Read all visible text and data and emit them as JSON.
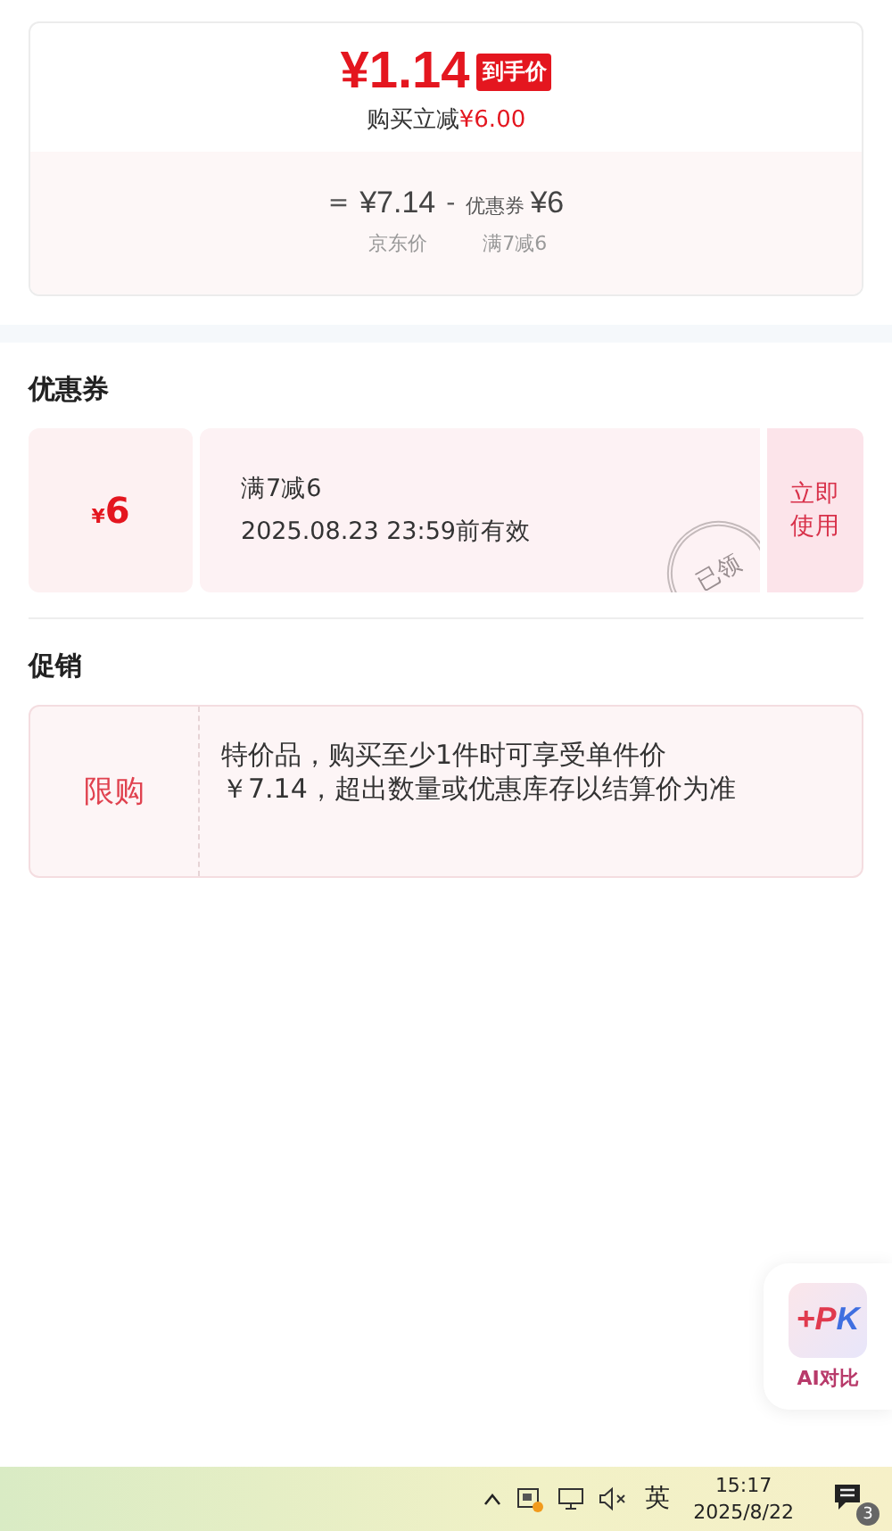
{
  "price_card": {
    "final_price": "¥1.14",
    "final_tag": "到手价",
    "saving_label": "购买立减",
    "saving_amount": "¥6.00",
    "formula": [
      {
        "kind": "op",
        "text": "="
      },
      {
        "kind": "amount",
        "text": "¥7.14",
        "caption": "京东价"
      },
      {
        "kind": "op",
        "text": "-"
      },
      {
        "kind": "coupon",
        "label": "优惠券",
        "text": "¥6",
        "caption": "满7减6"
      }
    ]
  },
  "coupons": {
    "title": "优惠券",
    "items": [
      {
        "amount_symbol": "¥",
        "amount": "6",
        "condition": "满7减6",
        "validity": "2025.08.23 23:59前有效",
        "claimed": true,
        "stamp": "已领",
        "action": "立即使用"
      }
    ]
  },
  "promotions": {
    "title": "促销",
    "items": [
      {
        "tag": "限购",
        "text": "特价品，购买至少1件时可享受单件价￥7.14，超出数量或优惠库存以结算价为准"
      }
    ]
  },
  "floating_button": {
    "logo": "+PK",
    "label": "AI对比"
  },
  "taskbar": {
    "input_method": "英",
    "time": "15:17",
    "date": "2025/8/22",
    "notification_count": "3"
  }
}
